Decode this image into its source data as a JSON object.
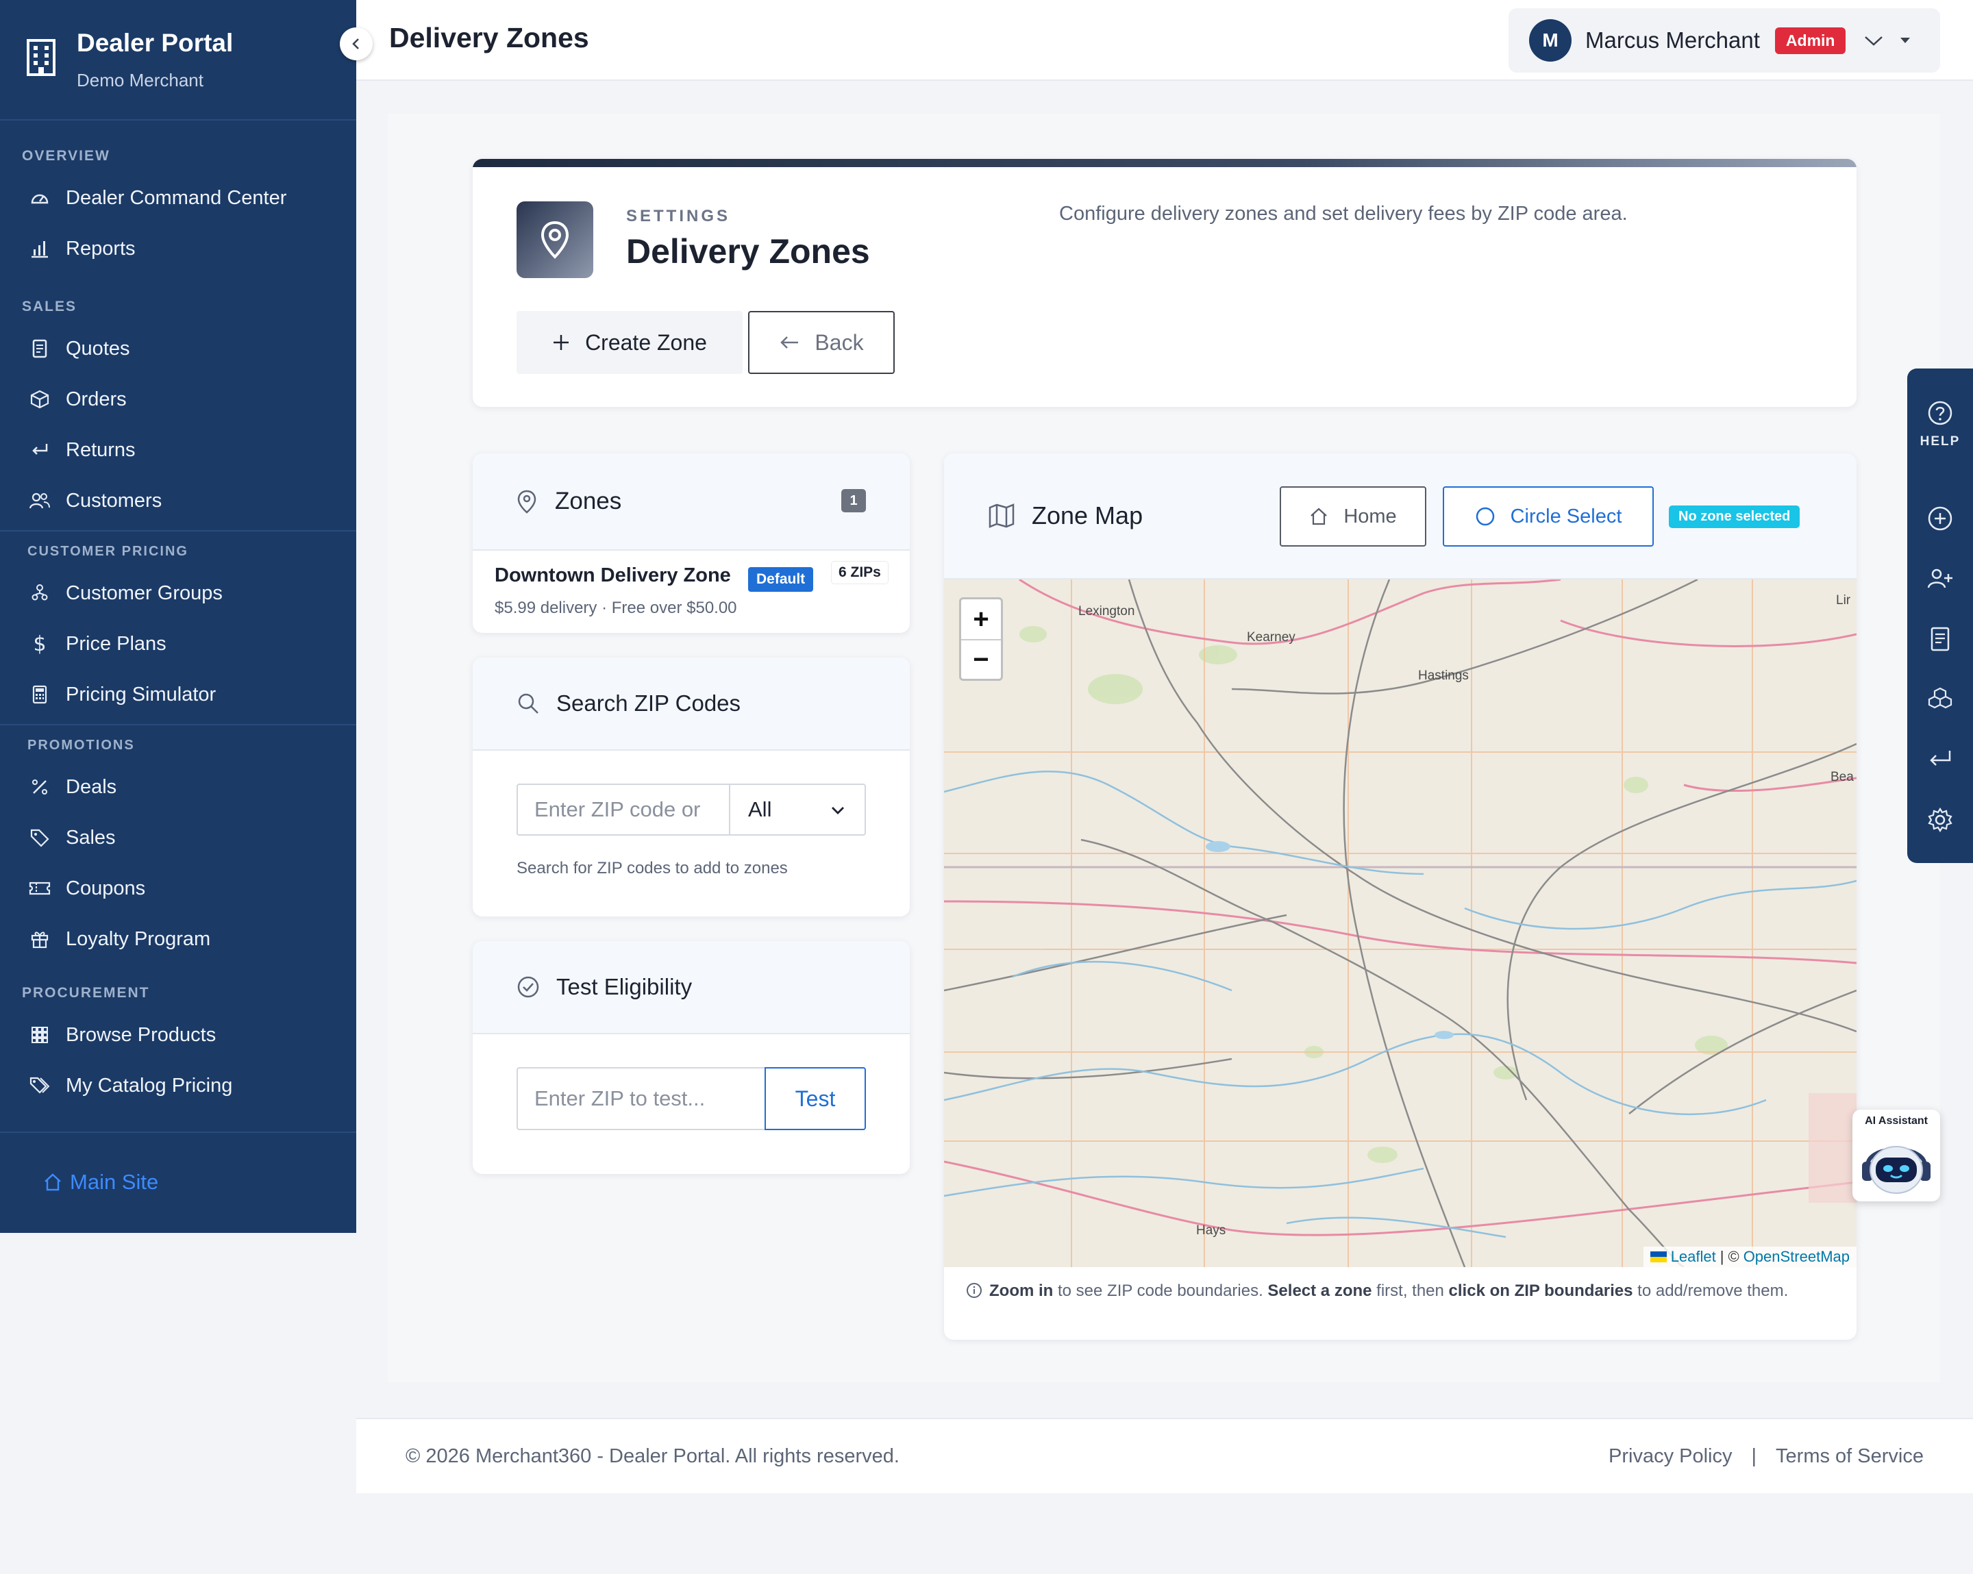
{
  "brand": {
    "title": "Dealer Portal",
    "subtitle": "Demo Merchant"
  },
  "sidebar": {
    "sections": [
      {
        "title": "OVERVIEW",
        "items": [
          {
            "label": "Dealer Command Center",
            "icon": "gauge-icon"
          },
          {
            "label": "Reports",
            "icon": "bar-chart-icon"
          }
        ]
      },
      {
        "title": "SALES",
        "items": [
          {
            "label": "Quotes",
            "icon": "document-icon"
          },
          {
            "label": "Orders",
            "icon": "box-icon"
          },
          {
            "label": "Returns",
            "icon": "return-arrow-icon"
          },
          {
            "label": "Customers",
            "icon": "users-icon"
          }
        ]
      },
      {
        "title": "CUSTOMER PRICING",
        "items": [
          {
            "label": "Customer Groups",
            "icon": "group-icon"
          },
          {
            "label": "Price Plans",
            "icon": "dollar-icon"
          },
          {
            "label": "Pricing Simulator",
            "icon": "calculator-icon"
          }
        ]
      },
      {
        "title": "PROMOTIONS",
        "items": [
          {
            "label": "Deals",
            "icon": "percent-icon"
          },
          {
            "label": "Sales",
            "icon": "tag-icon"
          },
          {
            "label": "Coupons",
            "icon": "ticket-icon"
          },
          {
            "label": "Loyalty Program",
            "icon": "gift-icon"
          }
        ]
      },
      {
        "title": "PROCUREMENT",
        "items": [
          {
            "label": "Browse Products",
            "icon": "grid-icon"
          },
          {
            "label": "My Catalog Pricing",
            "icon": "tags-icon"
          }
        ]
      }
    ],
    "footer_link": "Main Site"
  },
  "topbar": {
    "title": "Delivery Zones",
    "user_initial": "M",
    "user_name": "Marcus Merchant",
    "role_badge": "Admin"
  },
  "header_card": {
    "eyebrow": "SETTINGS",
    "title": "Delivery Zones",
    "description": "Configure delivery zones and set delivery fees by ZIP code area.",
    "create_label": "Create Zone",
    "back_label": "Back"
  },
  "zones_panel": {
    "title": "Zones",
    "count": "1",
    "items": [
      {
        "name": "Downtown Delivery Zone",
        "badge": "Default",
        "zips": "6 ZIPs",
        "details": "$5.99 delivery · Free over $50.00"
      }
    ]
  },
  "search_panel": {
    "title": "Search ZIP Codes",
    "placeholder": "Enter ZIP code or",
    "filter_value": "All",
    "help": "Search for ZIP codes to add to zones"
  },
  "test_panel": {
    "title": "Test Eligibility",
    "placeholder": "Enter ZIP to test...",
    "button": "Test"
  },
  "map_panel": {
    "title": "Zone Map",
    "home_label": "Home",
    "circle_label": "Circle Select",
    "status": "No zone selected",
    "places": {
      "lexington": "Lexington",
      "kearney": "Kearney",
      "hastings": "Hastings",
      "hays": "Hays",
      "lin": "Lir",
      "bea": "Bea"
    },
    "zoom_in": "+",
    "zoom_out": "−",
    "attribution": {
      "leaflet": "Leaflet",
      "sep": "|",
      "copy": "©",
      "osm": "OpenStreetMap"
    },
    "note": {
      "b1": "Zoom in",
      "t1": " to see ZIP code boundaries. ",
      "b2": "Select a zone",
      "t2": " first, then ",
      "b3": "click on ZIP boundaries",
      "t3": " to add/remove them."
    }
  },
  "right_rail": {
    "help_label": "HELP"
  },
  "ai_assistant": {
    "label": "AI Assistant"
  },
  "footer": {
    "copyright": "© 2026 Merchant360 - Dealer Portal. All rights reserved.",
    "privacy": "Privacy Policy",
    "separator": "|",
    "terms": "Terms of Service"
  },
  "colors": {
    "sidebar": "#1b3a66",
    "accent": "#1f6fd6",
    "danger": "#e02b3c",
    "info": "#19c4e6"
  }
}
